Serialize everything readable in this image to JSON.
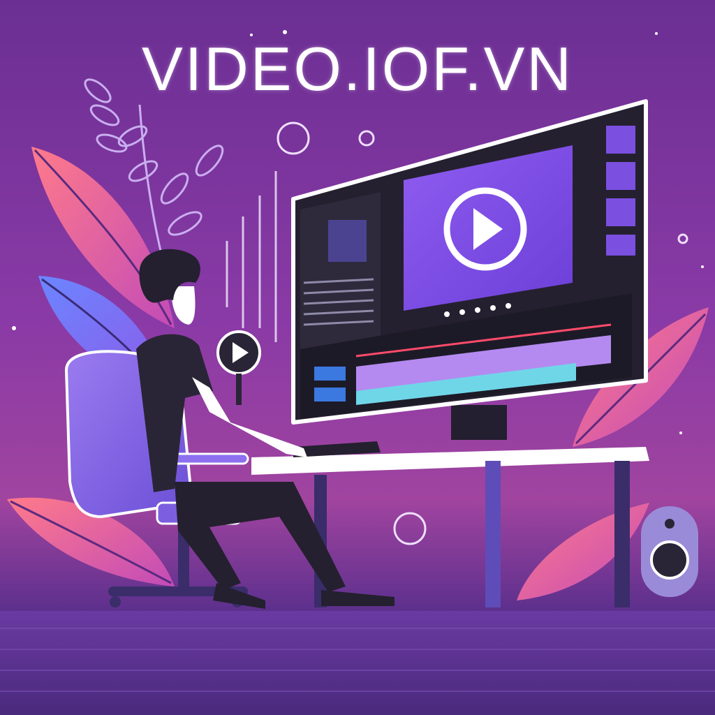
{
  "brand": {
    "title": "VIDEO.IOF.VN"
  },
  "icons": {
    "play": "play-icon",
    "speaker": "speaker-icon",
    "leaf": "leaf-icon"
  },
  "colors": {
    "background": "#6b2f93",
    "accent": "#8a52e6",
    "leaf": "#ff6f86",
    "screen": "#2b2838",
    "text": "#ffffff"
  }
}
